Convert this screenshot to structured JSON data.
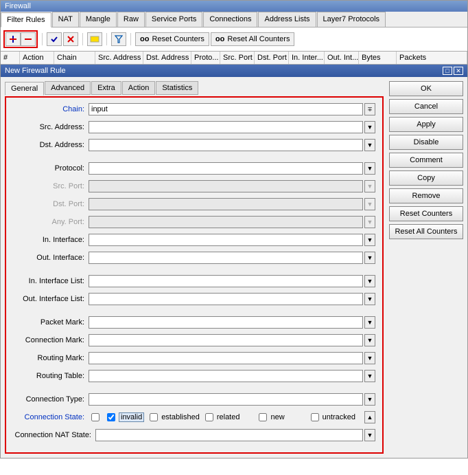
{
  "window_title": "Firewall",
  "main_tabs": [
    "Filter Rules",
    "NAT",
    "Mangle",
    "Raw",
    "Service Ports",
    "Connections",
    "Address Lists",
    "Layer7 Protocols"
  ],
  "main_tab_active": 0,
  "toolbar": {
    "reset_counters": "Reset Counters",
    "reset_all_counters": "Reset All Counters",
    "oo": "oo"
  },
  "columns": [
    "#",
    "Action",
    "Chain",
    "Src. Address",
    "Dst. Address",
    "Proto...",
    "Src. Port",
    "Dst. Port",
    "In. Inter...",
    "Out. Int...",
    "Bytes",
    "Packets"
  ],
  "dialog_title": "New Firewall Rule",
  "form_tabs": [
    "General",
    "Advanced",
    "Extra",
    "Action",
    "Statistics"
  ],
  "form_tab_active": 0,
  "fields": {
    "chain": {
      "label": "Chain:",
      "value": "input",
      "blue": true,
      "dd": "combo"
    },
    "src_address": {
      "label": "Src. Address:",
      "value": "",
      "dd": "caret"
    },
    "dst_address": {
      "label": "Dst. Address:",
      "value": "",
      "dd": "caret"
    },
    "protocol": {
      "label": "Protocol:",
      "value": "",
      "dd": "caret"
    },
    "src_port": {
      "label": "Src. Port:",
      "value": "",
      "disabled": true,
      "dd": "caret"
    },
    "dst_port": {
      "label": "Dst. Port:",
      "value": "",
      "disabled": true,
      "dd": "caret"
    },
    "any_port": {
      "label": "Any. Port:",
      "value": "",
      "disabled": true,
      "dd": "caret"
    },
    "in_interface": {
      "label": "In. Interface:",
      "value": "",
      "dd": "caret"
    },
    "out_interface": {
      "label": "Out. Interface:",
      "value": "",
      "dd": "caret"
    },
    "in_interface_list": {
      "label": "In. Interface List:",
      "value": "",
      "dd": "caret"
    },
    "out_interface_list": {
      "label": "Out. Interface List:",
      "value": "",
      "dd": "caret"
    },
    "packet_mark": {
      "label": "Packet Mark:",
      "value": "",
      "dd": "caret"
    },
    "connection_mark": {
      "label": "Connection Mark:",
      "value": "",
      "dd": "caret"
    },
    "routing_mark": {
      "label": "Routing Mark:",
      "value": "",
      "dd": "caret"
    },
    "routing_table": {
      "label": "Routing Table:",
      "value": "",
      "dd": "caret"
    },
    "connection_type": {
      "label": "Connection Type:",
      "value": "",
      "dd": "caret"
    },
    "connection_state": {
      "label": "Connection State:",
      "blue": true
    },
    "connection_nat_state": {
      "label": "Connection NAT State:",
      "value": "",
      "dd": "caret"
    }
  },
  "conn_states": {
    "invalid": {
      "label": "invalid",
      "checked": true
    },
    "established": {
      "label": "established",
      "checked": false
    },
    "related": {
      "label": "related",
      "checked": false
    },
    "new": {
      "label": "new",
      "checked": false
    },
    "untracked": {
      "label": "untracked",
      "checked": false
    }
  },
  "side_buttons": [
    "OK",
    "Cancel",
    "Apply",
    "Disable",
    "Comment",
    "Copy",
    "Remove",
    "Reset Counters",
    "Reset All Counters"
  ]
}
